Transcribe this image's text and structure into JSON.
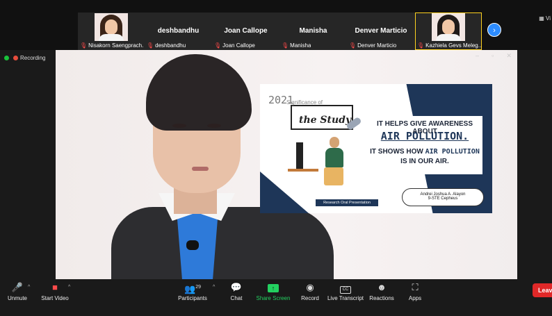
{
  "participants": [
    {
      "name": "Nisakorn Saengprach...",
      "has_video": true,
      "active": false
    },
    {
      "name": "deshbandhu",
      "has_video": false,
      "active": false
    },
    {
      "name": "Joan Callope",
      "has_video": false,
      "active": false
    },
    {
      "name": "Manisha",
      "has_video": false,
      "active": false
    },
    {
      "name": "Denver Marticio",
      "has_video": false,
      "active": false
    },
    {
      "name": "Kazhiela Gevs Meleg...",
      "has_video": true,
      "active": true
    }
  ],
  "status": {
    "recording_label": "Recording"
  },
  "view_label": "Vi",
  "slide": {
    "year": "2021",
    "title_small": "Significance of",
    "title_main": "the Study",
    "line1": "IT HELPS GIVE AWARENESS ABOUT",
    "line2": "AIR POLLUTION.",
    "line3a": "IT SHOWS HOW ",
    "line3b": "AIR POLLUTION",
    "line4": "IS IN OUR AIR.",
    "ribbon": "Research Oral Presentation",
    "author": "Andrei Joshua A. Alayon",
    "section": "9-STE Cepheus"
  },
  "toolbar": {
    "unmute": "Unmute",
    "start_video": "Start Video",
    "participants": "Participants",
    "participant_count": "29",
    "chat": "Chat",
    "share_screen": "Share Screen",
    "record": "Record",
    "live_transcript": "Live Transcript",
    "reactions": "Reactions",
    "apps": "Apps",
    "leave": "Leave",
    "cc": "CC"
  },
  "window_controls": {
    "minimize": "–",
    "restore": "▫",
    "close": "✕"
  },
  "colors": {
    "accent": "#2d8cff",
    "share": "#23d160",
    "leave": "#e02828",
    "muted": "#ff4a4a",
    "active_border": "#ffd21f"
  }
}
